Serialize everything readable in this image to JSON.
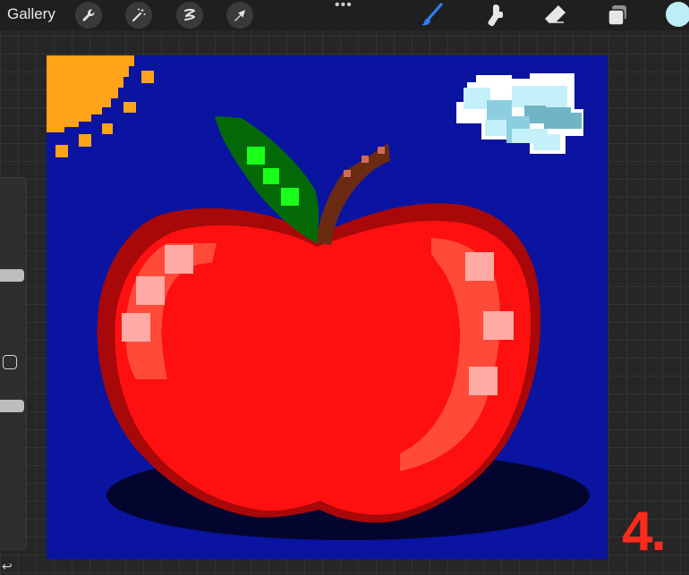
{
  "toolbar": {
    "gallery_label": "Gallery",
    "left_tools": [
      {
        "name": "wrench-icon"
      },
      {
        "name": "magic-wand-icon"
      },
      {
        "name": "selection-icon"
      },
      {
        "name": "transform-arrow-icon"
      }
    ],
    "more_label": "•••",
    "right_tools": [
      {
        "name": "brush-icon",
        "active": true
      },
      {
        "name": "smudge-icon",
        "active": false
      },
      {
        "name": "eraser-icon",
        "active": false
      },
      {
        "name": "layers-icon",
        "active": false
      }
    ],
    "active_color": "#bdeef6",
    "accent_color": "#2f7df5"
  },
  "sidebar": {
    "undo_glyph": "↩"
  },
  "canvas": {
    "background": "#0a14a0",
    "subject": "pixel-art apple"
  },
  "step_label": "4."
}
